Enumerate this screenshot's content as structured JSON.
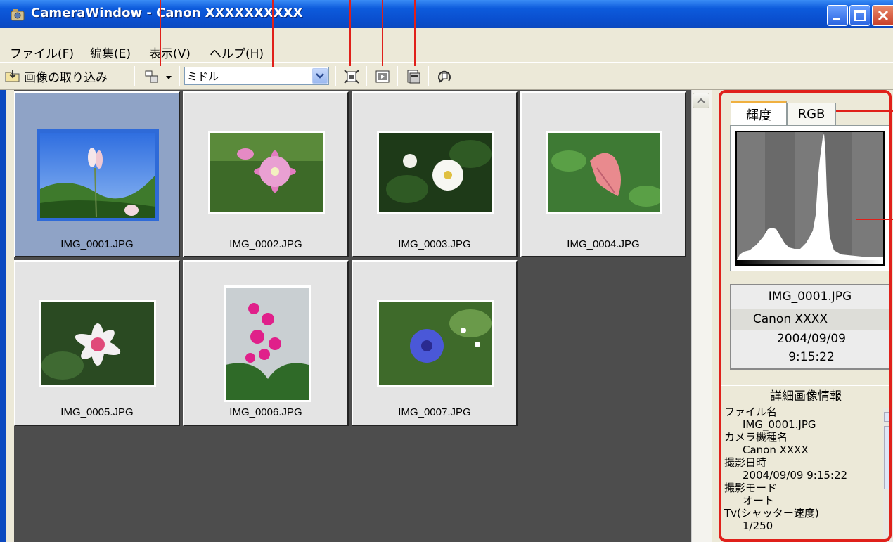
{
  "window": {
    "title": "CameraWindow - Canon XXXXXXXXXX",
    "buttons": {
      "minimize": "minimize",
      "maximize": "maximize",
      "close": "close"
    }
  },
  "menu": [
    {
      "label": "ファイル(F)"
    },
    {
      "label": "編集(E)"
    },
    {
      "label": "表示(V)"
    },
    {
      "label": "ヘルプ(H)"
    }
  ],
  "toolbar": {
    "import_label": "画像の取り込み",
    "size_value": "ミドル",
    "icons": [
      "import-folder-icon",
      "display-mode-icon",
      "dropdown-arrow-icon",
      "fit-view-icon",
      "slideshow-icon",
      "print-icon",
      "rotate-icon"
    ]
  },
  "gallery": {
    "items": [
      {
        "name": "IMG_0001.JPG",
        "selected": true,
        "subject": "pink flower under blue sky"
      },
      {
        "name": "IMG_0002.JPG",
        "selected": false,
        "subject": "pink clematis"
      },
      {
        "name": "IMG_0003.JPG",
        "selected": false,
        "subject": "white wild rose"
      },
      {
        "name": "IMG_0004.JPG",
        "selected": false,
        "subject": "pink bracts"
      },
      {
        "name": "IMG_0005.JPG",
        "selected": false,
        "subject": "pink lily"
      },
      {
        "name": "IMG_0006.JPG",
        "selected": false,
        "subject": "magenta primula"
      },
      {
        "name": "IMG_0007.JPG",
        "selected": false,
        "subject": "blue cornflower"
      }
    ]
  },
  "histogram": {
    "tabs": [
      "輝度",
      "RGB"
    ],
    "active_tab": "輝度"
  },
  "info": {
    "file": "IMG_0001.JPG",
    "camera": "Canon XXXX",
    "date": "2004/09/09",
    "time": "9:15:22"
  },
  "details": {
    "header": "詳細画像情報",
    "lines": [
      "ファイル名",
      "IMG_0001.JPG",
      "カメラ機種名",
      "Canon XXXX",
      "撮影日時",
      "2004/09/09 9:15:22",
      "撮影モード",
      "オート",
      "Tv(シャッター速度)",
      "1/250"
    ]
  },
  "colors": {
    "titlebar": "#0b49c0",
    "gallery_bg": "#4d4d4d",
    "selection": "#8fa3c6",
    "highlight": "#e0201a",
    "panel": "#ece9d8"
  }
}
